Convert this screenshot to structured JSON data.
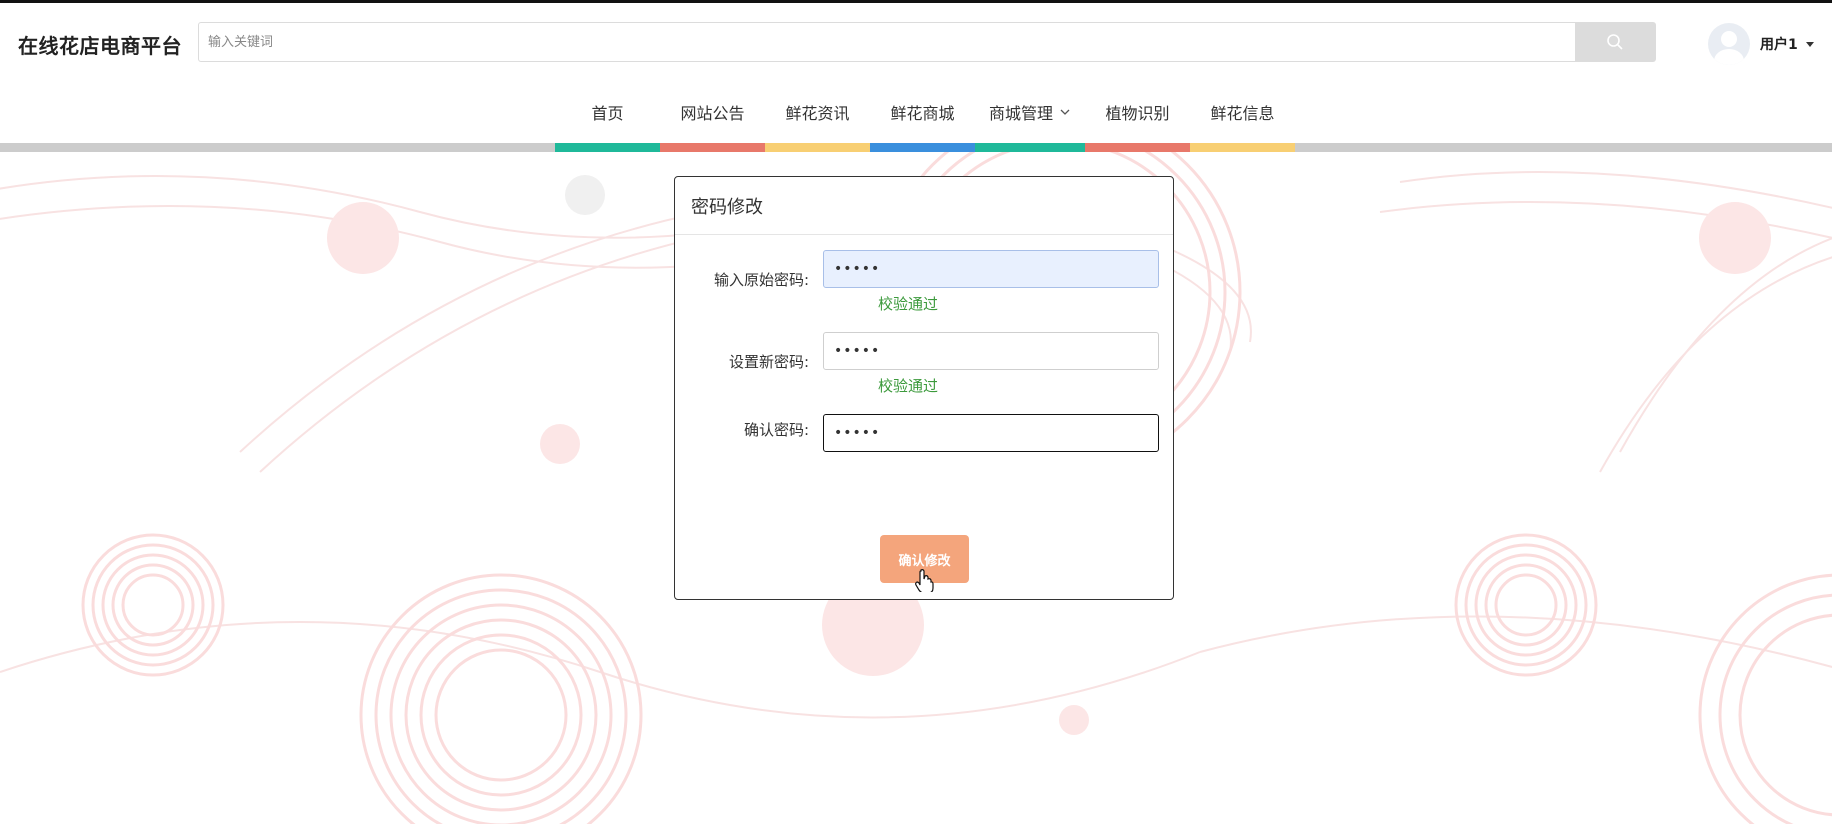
{
  "header": {
    "brand": "在线花店电商平台",
    "search": {
      "placeholder": "输入关键词",
      "value": ""
    },
    "user": {
      "name": "用户1"
    }
  },
  "nav": {
    "items": [
      {
        "label": "首页",
        "color": "#1fb99a"
      },
      {
        "label": "网站公告",
        "color": "#e8786a"
      },
      {
        "label": "鲜花资讯",
        "color": "#f8cf73"
      },
      {
        "label": "鲜花商城",
        "color": "#3a8fdd"
      },
      {
        "label": "商城管理",
        "color": "#1fb99a"
      },
      {
        "label": "植物识别",
        "color": "#e8786a"
      },
      {
        "label": "鲜花信息",
        "color": "#f8cf73"
      }
    ]
  },
  "form": {
    "title": "密码修改",
    "fields": [
      {
        "label": "输入原始密码:",
        "value": "•••••",
        "validation": "校验通过"
      },
      {
        "label": "设置新密码:",
        "value": "•••••",
        "validation": "校验通过"
      },
      {
        "label": "确认密码:",
        "value": "•••••",
        "validation": ""
      }
    ],
    "submit_label": "确认修改",
    "accent_color": "#f4a57c",
    "valid_color": "#3c9a3c"
  }
}
